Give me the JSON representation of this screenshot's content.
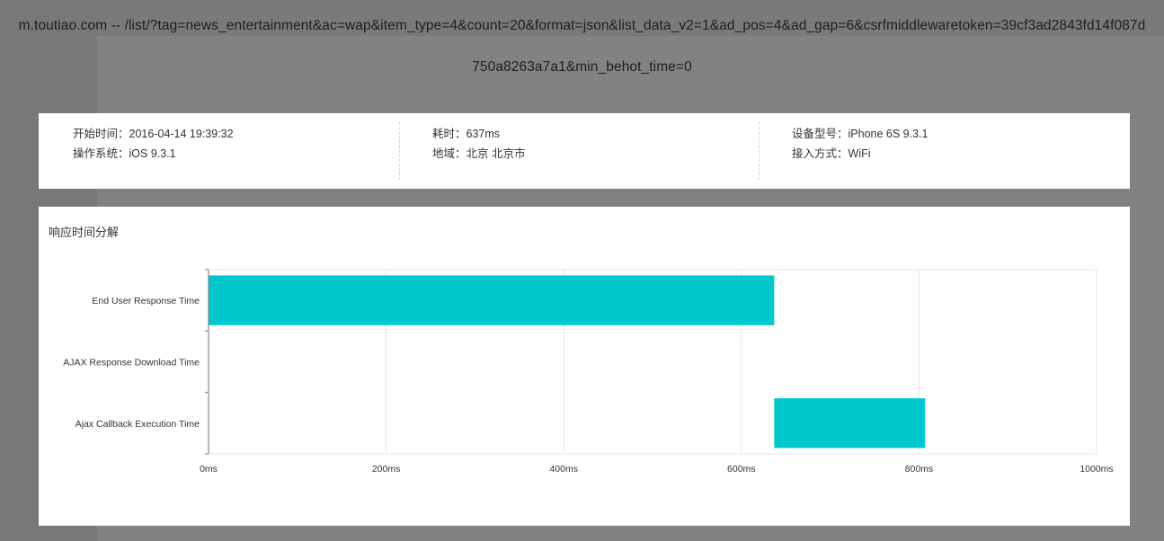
{
  "page": {
    "url_line1": "m.toutiao.com -- /list/?tag=news_entertainment&ac=wap&item_type=4&count=20&format=json&list_data_v2=1&ad_pos=4&ad_gap=6&csrfmiddlewaretoken=39cf3ad2843fd14f087d",
    "url_line2": "750a8263a7a1&min_behot_time=0"
  },
  "info": {
    "start_time_label": "开始时间：",
    "start_time_value": "2016-04-14 19:39:32",
    "os_label": "操作系统：",
    "os_value": "iOS 9.3.1",
    "duration_label": "耗时：",
    "duration_value": "637ms",
    "region_label": "地域：",
    "region_value": "北京 北京市",
    "device_label": "设备型号：",
    "device_value": "iPhone 6S 9.3.1",
    "access_label": "接入方式：",
    "access_value": "WiFi"
  },
  "chart_section": {
    "title": "响应时间分解"
  },
  "colors": {
    "bar": "#00c8cc",
    "grid": "#e6e6e6",
    "axis": "#c8c8c8"
  },
  "chart_data": {
    "type": "bar",
    "orientation": "horizontal",
    "categories": [
      "End User Response Time",
      "AJAX Response Download Time",
      "Ajax Callback Execution Time"
    ],
    "series": [
      {
        "ranges": [
          [
            0,
            637
          ],
          null,
          [
            637,
            807
          ]
        ]
      }
    ],
    "x_ticks": [
      "0ms",
      "200ms",
      "400ms",
      "600ms",
      "800ms",
      "1000ms"
    ],
    "xlim": [
      0,
      1000
    ],
    "grid": true,
    "legend": "none"
  }
}
